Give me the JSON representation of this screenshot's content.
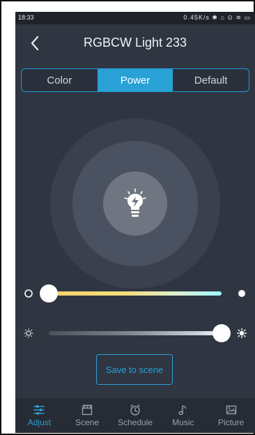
{
  "status": {
    "time": "18:33",
    "right": "0.45K/s ✱ ⌂ ⊙ ≋ ▭"
  },
  "header": {
    "title": "RGBCW Light 233"
  },
  "tabs": [
    {
      "label": "Color"
    },
    {
      "label": "Power",
      "active": true
    },
    {
      "label": "Default"
    }
  ],
  "power": {
    "icon": "bulb-power-icon"
  },
  "sliders": {
    "temperature": {
      "value": 0.0
    },
    "brightness": {
      "value": 1.0
    }
  },
  "actions": {
    "save_to_scene": "Save to scene"
  },
  "bottom_nav": [
    {
      "label": "Adjust",
      "icon": "adjust-icon",
      "active": true
    },
    {
      "label": "Scene",
      "icon": "clapper-icon"
    },
    {
      "label": "Schedule",
      "icon": "alarm-icon"
    },
    {
      "label": "Music",
      "icon": "music-note-icon"
    },
    {
      "label": "Picture",
      "icon": "image-icon"
    }
  ],
  "colors": {
    "accent": "#2aa1d6",
    "background": "#2f3541"
  }
}
